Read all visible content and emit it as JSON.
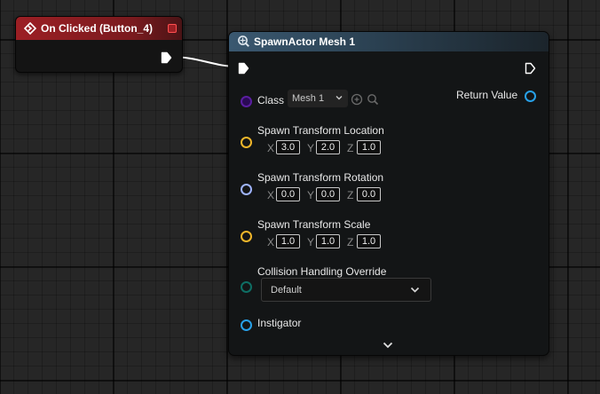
{
  "event_node": {
    "title": "On Clicked (Button_4)",
    "header_color": "#9c1f24"
  },
  "spawn_node": {
    "title": "SpawnActor Mesh 1",
    "header_color": "#3a5870",
    "class": {
      "label": "Class",
      "selected": "Mesh 1"
    },
    "return_value_label": "Return Value",
    "location": {
      "label": "Spawn Transform Location",
      "x": "3.0",
      "y": "2.0",
      "z": "1.0"
    },
    "rotation": {
      "label": "Spawn Transform Rotation",
      "x": "0.0",
      "y": "0.0",
      "z": "0.0"
    },
    "scale": {
      "label": "Spawn Transform Scale",
      "x": "1.0",
      "y": "1.0",
      "z": "1.0"
    },
    "collision": {
      "label": "Collision Handling Override",
      "selected": "Default"
    },
    "instigator_label": "Instigator"
  },
  "axis_labels": {
    "x": "X",
    "y": "Y",
    "z": "Z"
  },
  "pin_colors": {
    "exec": "#ffffff",
    "class": "#5a1ea0",
    "vector": "#f0b62a",
    "rotator": "#9fb4ff",
    "enum": "#0e6e64",
    "object": "#27a0e8"
  }
}
